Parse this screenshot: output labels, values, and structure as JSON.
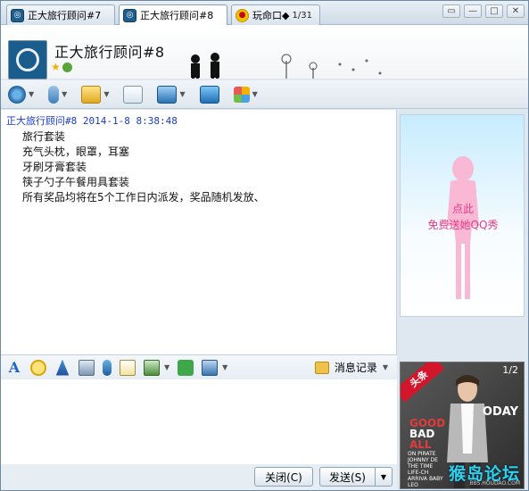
{
  "tabs": [
    {
      "label": "正大旅行顾问#7",
      "icon": "group-avatar-icon",
      "active": false
    },
    {
      "label": "正大旅行顾问#8",
      "icon": "group-avatar-icon",
      "active": true
    },
    {
      "label": "玩命口◆",
      "count": "1/31",
      "icon": "qq-penguin-icon",
      "active": false
    }
  ],
  "window_controls": {
    "restore": "▭",
    "minimize": "▭",
    "maximize": "□",
    "close": "✕"
  },
  "contact": {
    "name": "正大旅行顾问#8"
  },
  "toolbar": {
    "items": [
      "video-call-icon",
      "voice-call-icon",
      "send-file-icon",
      "create-group-icon",
      "remote-assist-icon",
      "share-screen-icon",
      "apps-icon"
    ]
  },
  "chat": {
    "sender_line": "正大旅行顾问#8 2014-1-8 8:38:48",
    "lines": [
      "旅行套装",
      "充气头枕，眼罩，耳塞",
      "牙刷牙膏套装",
      "筷子勺子午餐用具套装",
      "所有奖品均将在5个工作日内派发，奖品随机发放、"
    ]
  },
  "side_show": {
    "line1": "点此",
    "line2": "免费送她QQ秀"
  },
  "input_toolbar": {
    "font_glyph": "A",
    "history_label": "消息记录"
  },
  "buttons": {
    "close": "关闭(C)",
    "send": "发送(S)",
    "send_arrow": "▼"
  },
  "ad": {
    "hot_label": "头条",
    "pager": "1/2",
    "today": "ODAY",
    "good": "GOOD",
    "bad": "BAD",
    "all": "ALL",
    "small_text": "ON PIRATE JOHNNY DE THE TIME LIFE-CH ARRIVA BABY LEO",
    "forum": "猴岛论坛",
    "url": "BBS.HOUDAO.COM"
  },
  "colors": {
    "sender": "#1a3cc8",
    "promo_pink": "#ea3a86",
    "ad_red": "#d4162c",
    "forum_cyan": "#2dd4e8"
  }
}
